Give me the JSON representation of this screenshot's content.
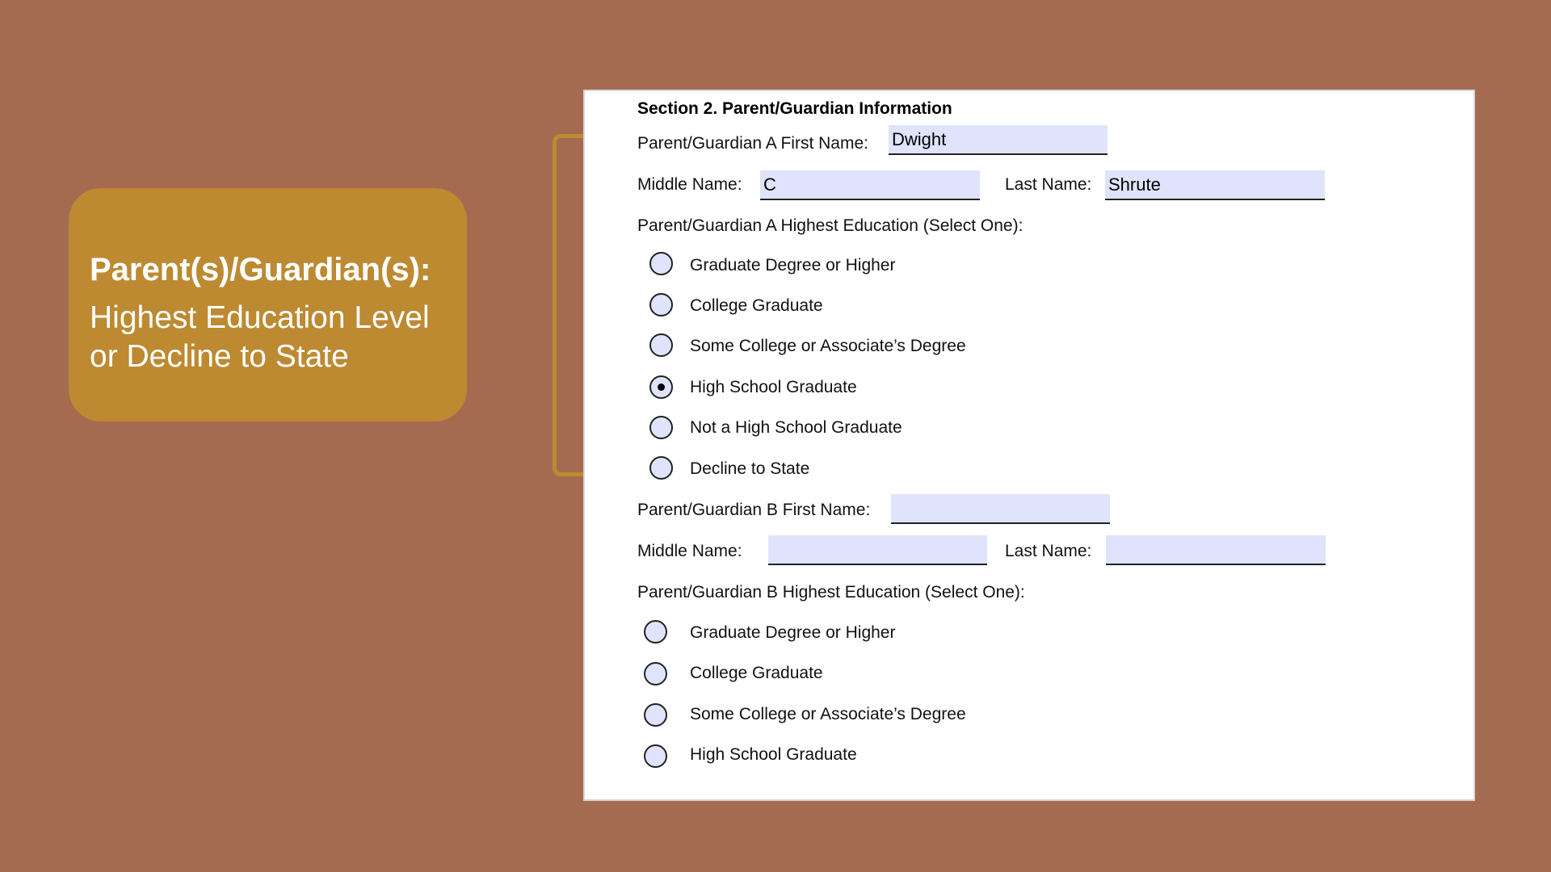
{
  "callout": {
    "title": "Parent(s)/Guardian(s):",
    "line1": "Highest Education Level",
    "line2": "or Decline to State"
  },
  "form": {
    "section_title": "Section 2. Parent/Guardian Information",
    "guardian_a": {
      "first_name_label": "Parent/Guardian A First Name:",
      "first_name_value": "Dwight",
      "middle_name_label": "Middle Name:",
      "middle_name_value": "C",
      "last_name_label": "Last Name:",
      "last_name_value": "Shrute",
      "education_label": "Parent/Guardian A Highest Education (Select One):",
      "options": [
        {
          "label": "Graduate Degree or Higher",
          "selected": false
        },
        {
          "label": "College Graduate",
          "selected": false
        },
        {
          "label": "Some College or Associate’s Degree",
          "selected": false
        },
        {
          "label": "High School Graduate",
          "selected": true
        },
        {
          "label": "Not a High School Graduate",
          "selected": false
        },
        {
          "label": "Decline to State",
          "selected": false
        }
      ]
    },
    "guardian_b": {
      "first_name_label": "Parent/Guardian B First Name:",
      "first_name_value": "",
      "middle_name_label": "Middle Name:",
      "middle_name_value": "",
      "last_name_label": "Last Name:",
      "last_name_value": "",
      "education_label": "Parent/Guardian B Highest Education (Select One):",
      "options": [
        {
          "label": "Graduate Degree or Higher",
          "selected": false
        },
        {
          "label": "College Graduate",
          "selected": false
        },
        {
          "label": "Some College or Associate’s Degree",
          "selected": false
        },
        {
          "label": "High School Graduate",
          "selected": false
        }
      ]
    }
  },
  "colors": {
    "background": "#a56b51",
    "callout": "#bd8a32",
    "field_fill": "#dfe4fc"
  }
}
